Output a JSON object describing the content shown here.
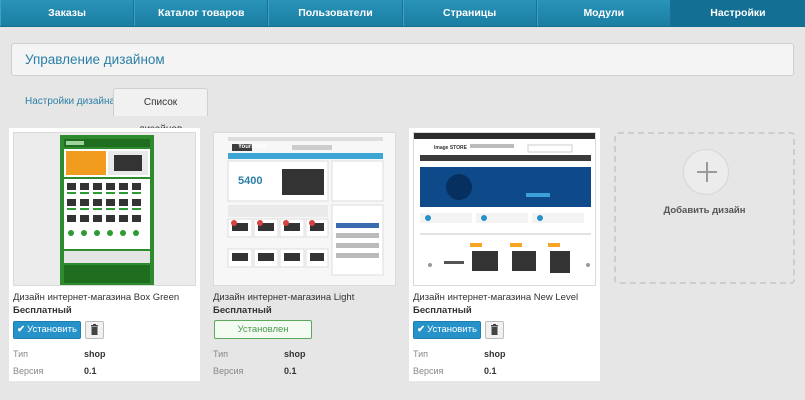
{
  "nav": {
    "items": [
      {
        "label": "Заказы"
      },
      {
        "label": "Каталог товаров"
      },
      {
        "label": "Пользователи"
      },
      {
        "label": "Страницы"
      },
      {
        "label": "Модули"
      },
      {
        "label": "Настройки"
      }
    ],
    "active_index": 5
  },
  "page": {
    "title": "Управление дизайном"
  },
  "tabs": [
    {
      "label": "Настройки дизайна"
    },
    {
      "label": "Список дизайнов"
    }
  ],
  "designs": [
    {
      "name": "Дизайн интернет-магазина Box Green",
      "price": "Бесплатный",
      "action": "Установить",
      "type_label": "Тип",
      "type_value": "shop",
      "version_label": "Версия",
      "version_value": "0.1"
    },
    {
      "name": "Дизайн интернет-магазина Light",
      "price": "Бесплатный",
      "action": "Установлен",
      "type_label": "Тип",
      "type_value": "shop",
      "version_label": "Версия",
      "version_value": "0.1",
      "preview": {
        "logo": "YourStore",
        "banner_price": "5400"
      }
    },
    {
      "name": "Дизайн интернет-магазина New Level",
      "price": "Бесплатный",
      "action": "Установить",
      "type_label": "Тип",
      "type_value": "shop",
      "version_label": "Версия",
      "version_value": "0.1",
      "preview": {
        "logo": "Image STORE"
      }
    }
  ],
  "add_design": {
    "label": "Добавить дизайн"
  },
  "colors": {
    "nav": "#1b7ea3",
    "accent": "#2593c9",
    "installed": "#5ba85e",
    "green_theme": "#2e9a33"
  },
  "icons": {
    "install": "check-icon",
    "delete": "trash-icon",
    "add": "plus-icon"
  }
}
